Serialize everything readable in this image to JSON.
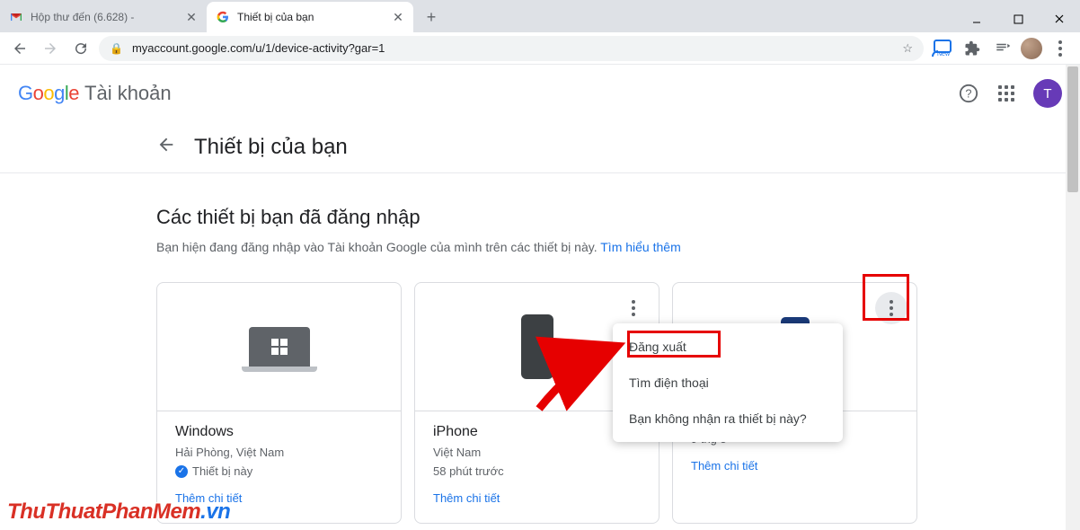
{
  "browser": {
    "tabs": [
      {
        "title": "Hộp thư đến (6.628) -",
        "active": false
      },
      {
        "title": "Thiết bị của bạn",
        "active": true
      }
    ],
    "url": "myaccount.google.com/u/1/device-activity?gar=1",
    "ext_new": "New"
  },
  "header": {
    "product": "Tài khoản",
    "avatar_letter": "T"
  },
  "page": {
    "title": "Thiết bị của bạn",
    "section_title": "Các thiết bị bạn đã đăng nhập",
    "section_sub": "Bạn hiện đang đăng nhập vào Tài khoản Google của mình trên các thiết bị này.",
    "learn_more": "Tìm hiểu thêm"
  },
  "devices": [
    {
      "name": "Windows",
      "line1": "Hải Phòng, Việt Nam",
      "this_device": "Thiết bị này",
      "more": "Thêm chi tiết"
    },
    {
      "name": "iPhone",
      "line1": "Việt Nam",
      "line2": "58 phút trước",
      "more": "Thêm chi tiết"
    },
    {
      "name": "",
      "line1": "",
      "line2": "9 thg 5",
      "more": "Thêm chi tiết"
    }
  ],
  "menu": {
    "sign_out": "Đăng xuất",
    "find_phone": "Tìm điện thoại",
    "not_recognize": "Bạn không nhận ra thiết bị này?"
  },
  "watermark": {
    "part1": "ThuThuatPhanMem",
    "part2": ".vn"
  }
}
